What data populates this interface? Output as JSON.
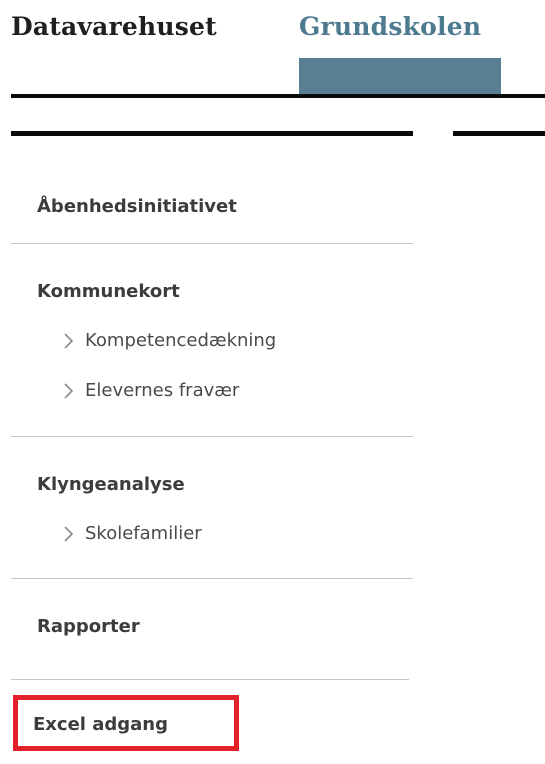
{
  "header": {
    "tabs": [
      {
        "label": "Datavarehuset"
      },
      {
        "label": "Grundskolen"
      }
    ]
  },
  "sidebar": {
    "sections": [
      {
        "heading": "Åbenhedsinitiativet"
      },
      {
        "heading": "Kommunekort",
        "items": [
          {
            "label": "Kompetencedækning"
          },
          {
            "label": "Elevernes fravær"
          }
        ]
      },
      {
        "heading": "Klyngeanalyse",
        "items": [
          {
            "label": "Skolefamilier"
          }
        ]
      },
      {
        "heading": "Rapporter"
      },
      {
        "heading": "Excel adgang",
        "highlighted": true
      }
    ]
  },
  "colors": {
    "active_tab": "#4e7a90",
    "tab_indicator": "#5a7f92",
    "highlight_border": "#e3212b"
  },
  "icons": {
    "subitem": "chevron-right-icon"
  }
}
